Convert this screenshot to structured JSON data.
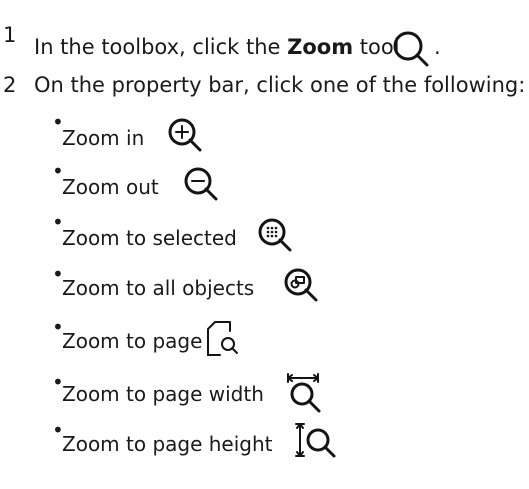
{
  "steps": [
    {
      "number": "1",
      "text_before": "In the toolbox, click the ",
      "text_bold": "Zoom",
      "text_after": " tool",
      "trailing": ".",
      "icon": "zoom-tool-icon"
    },
    {
      "number": "2",
      "text": "On the property bar, click one of the following:"
    }
  ],
  "options": [
    {
      "bullet": "•",
      "label": "Zoom in",
      "icon": "zoom-in-icon"
    },
    {
      "bullet": "•",
      "label": "Zoom out",
      "icon": "zoom-out-icon"
    },
    {
      "bullet": "•",
      "label": "Zoom to selected",
      "icon": "zoom-to-selected-icon"
    },
    {
      "bullet": "•",
      "label": "Zoom to all objects",
      "icon": "zoom-to-all-objects-icon"
    },
    {
      "bullet": "•",
      "label": "Zoom to page",
      "icon": "zoom-to-page-icon"
    },
    {
      "bullet": "•",
      "label": "Zoom to page width",
      "icon": "zoom-to-page-width-icon"
    },
    {
      "bullet": "•",
      "label": "Zoom to page height",
      "icon": "zoom-to-page-height-icon"
    }
  ]
}
